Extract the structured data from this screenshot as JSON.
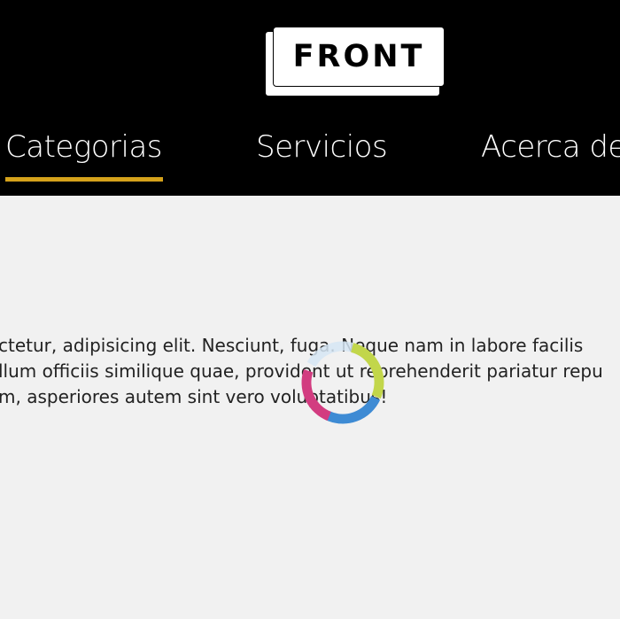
{
  "header": {
    "logo_text": "FRONT",
    "nav": [
      {
        "label": "Categorias",
        "active": true
      },
      {
        "label": "Servicios",
        "active": false
      },
      {
        "label": "Acerca de",
        "active": false
      }
    ],
    "background_color": "#000000",
    "active_underline_color": "#d5a21b"
  },
  "main": {
    "paragraph_lines": [
      "ctetur, adipisicing elit. Nesciunt, fuga. Neque nam in labore facilis",
      "llum officiis similique quae, provident ut reprehenderit pariatur repu",
      "m, asperiores autem sint vero voluptatibus!"
    ],
    "background_color": "#f1f1f1"
  },
  "loader": {
    "icon": "loading-spinner-icon",
    "colors": [
      "#c2d64a",
      "#3e8bd4",
      "#d23c80",
      "#d6e6f5"
    ]
  }
}
